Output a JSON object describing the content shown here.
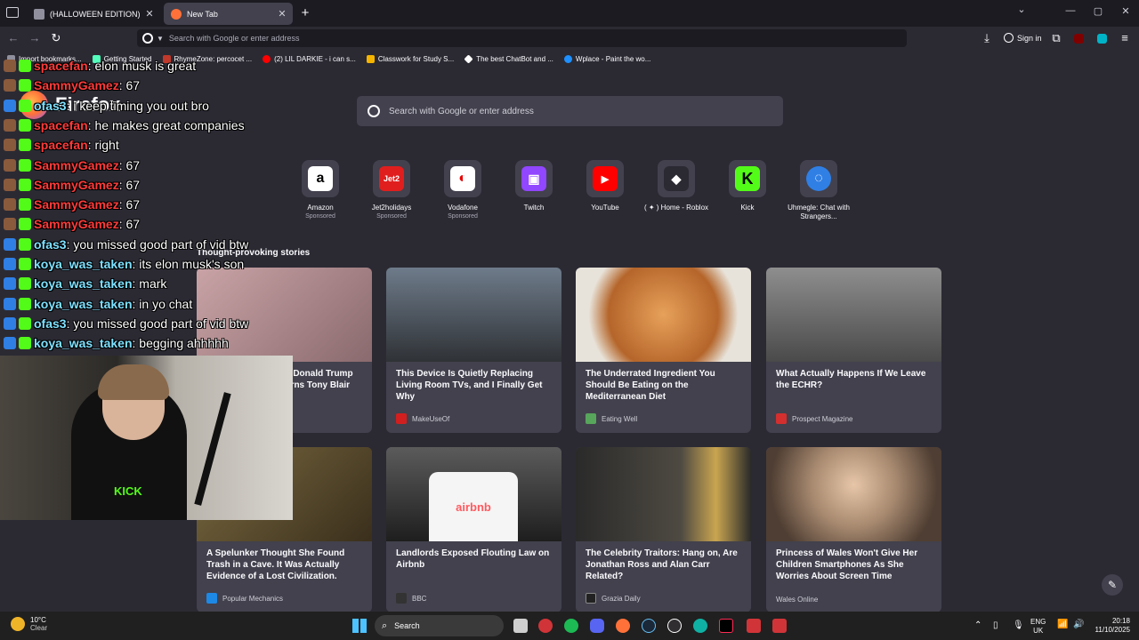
{
  "colors": {
    "firefox_bg": "#2b2a33",
    "card_bg": "#42414d",
    "chat_green": "#53fc18",
    "chat_red": "#ff3b3b",
    "chat_cyan": "#7ee1ff"
  },
  "tabs": [
    {
      "title": "(HALLOWEEN EDITION) DIVZIN",
      "close": "✕"
    },
    {
      "title": "New Tab",
      "close": "✕"
    }
  ],
  "tab_new": "+",
  "window_controls": {
    "list": "⌄",
    "min": "—",
    "max": "▢",
    "close": "✕"
  },
  "urlbar": {
    "placeholder": "Search with Google or enter address"
  },
  "toolbar": {
    "sign_in": "Sign in"
  },
  "bookmarks": [
    {
      "label": "Import bookmarks...",
      "color": "#8f8f9d"
    },
    {
      "label": "Getting Started",
      "color": "#54ffbd"
    },
    {
      "label": "RhymeZone: percocet ...",
      "color": "#c0392b"
    },
    {
      "label": "(2) LIL DARKIE - i can s...",
      "color": "#ff0000"
    },
    {
      "label": "Classwork for Study S...",
      "color": "#f4b400"
    },
    {
      "label": "The best ChatBot and ...",
      "color": "#ffffff"
    },
    {
      "label": "Wplace - Paint the wo...",
      "color": "#1e90ff"
    }
  ],
  "newtab": {
    "brand": "Firefox",
    "search_placeholder": "Search with Google or enter address",
    "shortcuts": [
      {
        "name": "Amazon",
        "sponsored": "Sponsored",
        "logo": "a",
        "bg": "#ffffff",
        "fg": "#000000"
      },
      {
        "name": "Jet2holidays",
        "sponsored": "Sponsored",
        "logo": "Jet2",
        "bg": "#e01e1e",
        "fg": "#ffffff"
      },
      {
        "name": "Vodafone",
        "sponsored": "Sponsored",
        "logo": "◐",
        "bg": "#ffffff",
        "fg": "#e60000"
      },
      {
        "name": "Twitch",
        "sponsored": "",
        "logo": "▣",
        "bg": "#9146ff",
        "fg": "#ffffff"
      },
      {
        "name": "YouTube",
        "sponsored": "",
        "logo": "▶",
        "bg": "#ff0000",
        "fg": "#ffffff"
      },
      {
        "name": "( ✦ ) Home - Roblox",
        "sponsored": "",
        "logo": "◆",
        "bg": "#2b2a33",
        "fg": "#ffffff"
      },
      {
        "name": "Kick",
        "sponsored": "",
        "logo": "K",
        "bg": "#53fc18",
        "fg": "#000000"
      },
      {
        "name": "Uhmegle: Chat with Strangers...",
        "sponsored": "",
        "logo": "◌",
        "bg": "#2f7fe5",
        "fg": "#ffffff"
      }
    ],
    "stories_title": "Thought-provoking stories",
    "stories": [
      {
        "title": "s Donald Trump arns Tony Blair",
        "source": "",
        "icon_color": "#42414d",
        "img": "#8a6a6e"
      },
      {
        "title": "This Device Is Quietly Replacing Living Room TVs, and I Finally Get Why",
        "source": "MakeUseOf",
        "icon_color": "#d11f1f",
        "img": "#4a4a4a"
      },
      {
        "title": "The Underrated Ingredient You Should Be Eating on the Mediterranean Diet",
        "source": "Eating Well",
        "icon_color": "#58a55c",
        "img": "#b5652a"
      },
      {
        "title": "What Actually Happens If We Leave the ECHR?",
        "source": "Prospect Magazine",
        "icon_color": "#d32f2f",
        "img": "#6d6d6d"
      },
      {
        "title": "A Spelunker Thought She Found Trash in a Cave. It Was Actually Evidence of a Lost Civilization.",
        "source": "Popular Mechanics",
        "icon_color": "#1e88e5",
        "img": "#5a4a30"
      },
      {
        "title": "Landlords Exposed Flouting Law on Airbnb",
        "source": "BBC",
        "icon_color": "#333333",
        "img": "#3c3c3c"
      },
      {
        "title": "The Celebrity Traitors: Hang on, Are Jonathan Ross and Alan Carr Related?",
        "source": "Grazia Daily",
        "icon_color": "#222222",
        "img": "#2d2d2d"
      },
      {
        "title": "Princess of Wales Won't Give Her Children Smartphones As She Worries About Screen Time",
        "source": "Wales Online",
        "icon_color": "#42414d",
        "img": "#a88a70"
      }
    ]
  },
  "chat": [
    {
      "user": "spacefan",
      "text": ": elon musk is great",
      "color": "#ff3b3b"
    },
    {
      "user": "SammyGamez",
      "text": ": 67",
      "color": "#ff3b3b"
    },
    {
      "user": "ofas3",
      "text": ": i keep timing you out bro",
      "color": "#7ee1ff"
    },
    {
      "user": "spacefan",
      "text": ": he makes great companies",
      "color": "#ff3b3b"
    },
    {
      "user": "spacefan",
      "text": ": right",
      "color": "#ff3b3b"
    },
    {
      "user": "SammyGamez",
      "text": ": 67",
      "color": "#ff3b3b"
    },
    {
      "user": "SammyGamez",
      "text": ": 67",
      "color": "#ff3b3b"
    },
    {
      "user": "SammyGamez",
      "text": ": 67",
      "color": "#ff3b3b"
    },
    {
      "user": "SammyGamez",
      "text": ": 67",
      "color": "#ff3b3b"
    },
    {
      "user": "ofas3",
      "text": ": you missed good part of vid btw",
      "color": "#7ee1ff"
    },
    {
      "user": "koya_was_taken",
      "text": ": its elon musk's son",
      "color": "#7ee1ff"
    },
    {
      "user": "koya_was_taken",
      "text": ": mark",
      "color": "#7ee1ff"
    },
    {
      "user": "koya_was_taken",
      "text": ": in yo chat",
      "color": "#7ee1ff"
    },
    {
      "user": "ofas3",
      "text": ": you missed good part of vid btw",
      "color": "#7ee1ff"
    },
    {
      "user": "koya_was_taken",
      "text": ": begging ahhhhh",
      "color": "#7ee1ff"
    }
  ],
  "taskbar": {
    "weather_temp": "10°C",
    "weather_desc": "Clear",
    "search": "Search",
    "lang": "ENG",
    "region": "UK",
    "time": "20:18",
    "date": "11/10/2025"
  }
}
